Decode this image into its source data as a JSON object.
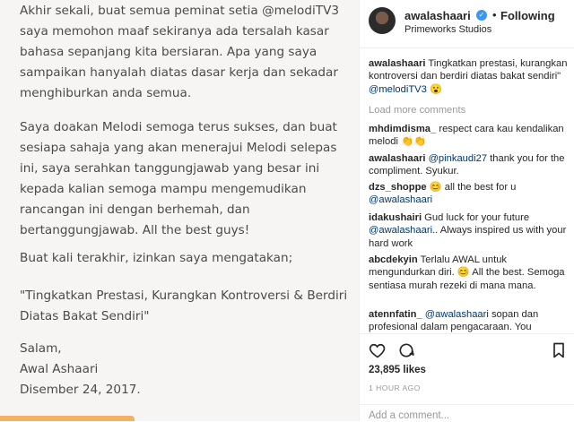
{
  "post_image": {
    "para1": "Akhir sekali, buat semua peminat setia @melodiTV3\nsaya memohon maaf sekiranya ada tersalah kasar\nbahasa sepanjang kita bersiaran. Apa yang saya\nsampaikan hanyalah diatas dasar kerja dan sekadar\nmenghiburkan anda semua.",
    "para2": "Saya doakan Melodi semoga terus sukses, dan buat\nsesiapa sahaja yang akan menerajui Melodi selepas\nini, saya serahkan tanggungjawab yang besar ini\nkepada kalian semoga mampu mengemudikan\nrancangan ini dengan berhemah, dan\nbertanggungjawab. All the best guys!",
    "para3": "Buat kali terakhir, izinkan saya mengatakan;",
    "para4": "\"Tingkatkan Prestasi, Kurangkan Kontroversi & Berdiri\nDiatas Bakat Sendiri\"",
    "para5": "Salam,\nAwal Ashaari\nDisember 24, 2017."
  },
  "header": {
    "username": "awalashaari",
    "verified": "✓",
    "separator": "•",
    "follow_status": "Following",
    "location": "Primeworks Studios"
  },
  "caption": {
    "username": "awalashaari",
    "text": " Tingkatkan prestasi, kurangkan kontroversi dan berdiri diatas bakat sendiri\" ",
    "mention": "@melodiTV3",
    "emoji": " 😮"
  },
  "load_more": "Load more comments",
  "comments": [
    {
      "user": "mhdimdisma_",
      "pre": " respect cara kau kendalikan melodi 👏👏",
      "mention": "",
      "post": ""
    },
    {
      "user": "awalashaari",
      "pre": " ",
      "mention": "@pinkaudi27",
      "post": " thank you for the compliment. Syukur."
    },
    {
      "user": "dzs_shoppe",
      "pre": " 😊 all the best for u ",
      "mention": "@awalashaari",
      "post": ""
    },
    {
      "user": "idakushairi",
      "pre": " Gud luck for your future ",
      "mention": "@awalashaari",
      "post": ".. Always inspired us with your hard work"
    },
    {
      "user": "abcdekyin",
      "pre": " Terlalu AWAL untuk mengundurkan diri. 😊 All the best. Semoga sentiasa murah rezeki di mana mana.",
      "mention": "",
      "post": ""
    },
    {
      "user": "atennfatin_",
      "pre": " ",
      "mention": "@awalashaari",
      "post": " sopan dan profesional dalam pengacaraan. You"
    }
  ],
  "likes": "23,895 likes",
  "time_ago": "1 HOUR AGO",
  "add_comment_placeholder": "Add a comment...",
  "icons": [
    "heart-icon",
    "comment-icon",
    "bookmark-icon"
  ],
  "colors": {
    "accent": "#3897f0",
    "mention": "#003569",
    "muted": "#999999",
    "strip": "#f3b061"
  }
}
